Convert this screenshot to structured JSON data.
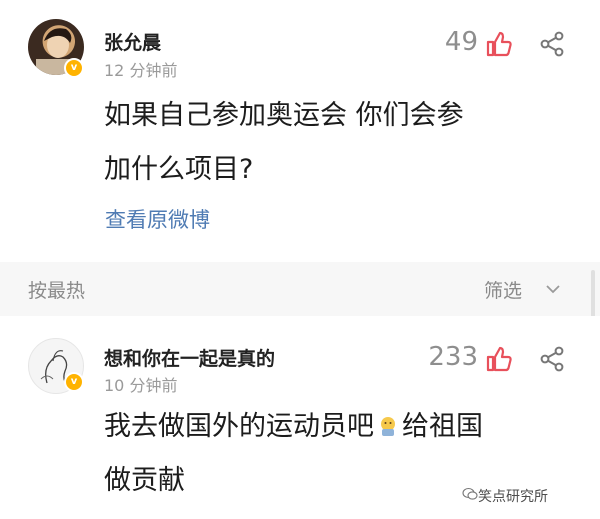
{
  "post": {
    "author": "张允晨",
    "time": "12 分钟前",
    "like_count": "49",
    "text_line1": "如果自己参加奥运会 你们会参",
    "text_line2": "加什么项目?",
    "view_original": "查看原微博"
  },
  "sort_bar": {
    "sort_label": "按最热",
    "filter_label": "筛选"
  },
  "comment": {
    "author": "想和你在一起是真的",
    "time": "10 分钟前",
    "like_count": "233",
    "text_line1a": "我去做国外的运动员吧",
    "text_line1b": "给祖国",
    "text_line2": "做贡献"
  },
  "watermark": "笑点研究所",
  "colors": {
    "link": "#4f7bb3",
    "like_icon": "#e8505b",
    "badge": "#ffb300",
    "muted": "#9a9a9a"
  },
  "icons": [
    "thumb-up-icon",
    "share-icon",
    "chevron-down-icon",
    "verified-badge-icon",
    "emoji-icon",
    "wechat-icon"
  ]
}
